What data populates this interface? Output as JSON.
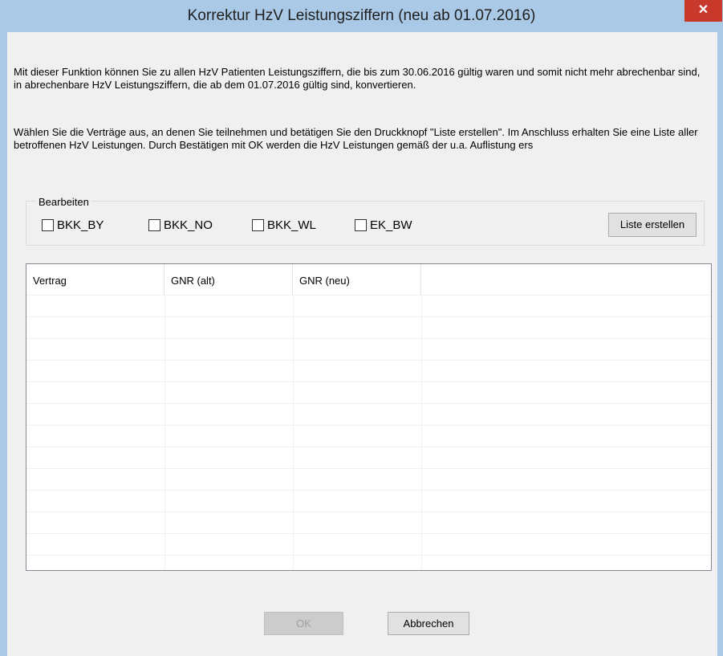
{
  "window": {
    "title": "Korrektur HzV Leistungsziffern (neu ab 01.07.2016)",
    "close_symbol": "✕"
  },
  "description": {
    "paragraph1": "Mit dieser Funktion können Sie zu allen HzV Patienten Leistungsziffern, die bis zum 30.06.2016 gültig waren und somit nicht mehr abrechenbar sind, in abrechenbare HzV Leistungsziffern, die ab dem 01.07.2016 gültig sind, konvertieren.",
    "paragraph2": "Wählen Sie die Verträge aus, an denen Sie teilnehmen und betätigen Sie den Druckknopf \"Liste erstellen\". Im Anschluss erhalten Sie eine Liste aller betroffenen HzV Leistungen. Durch Bestätigen mit OK werden die HzV Leistungen gemäß der u.a. Auflistung ers"
  },
  "group": {
    "label": "Bearbeiten",
    "checkboxes": [
      {
        "label": "BKK_BY",
        "checked": false
      },
      {
        "label": "BKK_NO",
        "checked": false
      },
      {
        "label": "BKK_WL",
        "checked": false
      },
      {
        "label": "EK_BW",
        "checked": false
      }
    ],
    "create_list_label": "Liste erstellen"
  },
  "table": {
    "columns": [
      "Vertrag",
      "GNR (alt)",
      "GNR (neu)"
    ],
    "rows": []
  },
  "buttons": {
    "ok_label": "OK",
    "ok_enabled": false,
    "cancel_label": "Abbrechen"
  },
  "colors": {
    "title_bar": "#a9c9e6",
    "close_button": "#c8392b",
    "dialog_background": "#f0f0f0"
  }
}
